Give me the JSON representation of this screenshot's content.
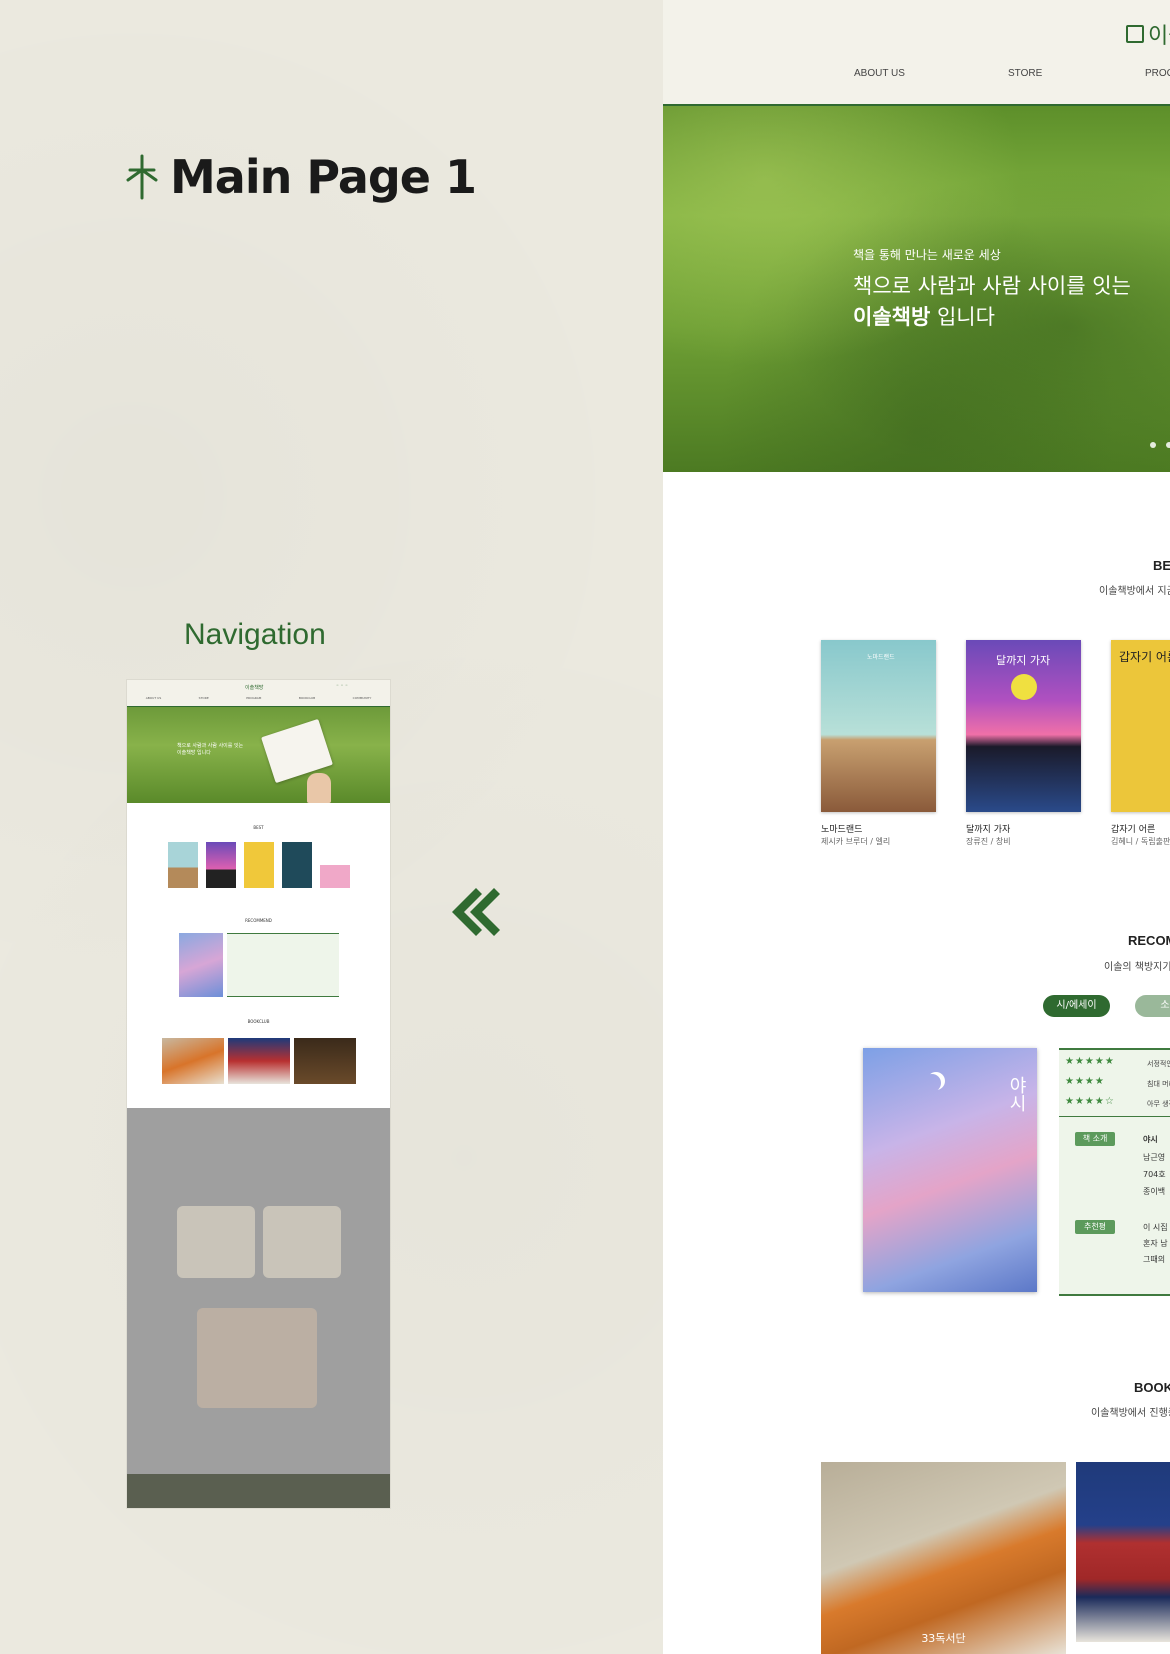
{
  "left": {
    "page_title": "Main Page 1",
    "nav_caption": "Navigation",
    "icons": {
      "title_icon": "tree-icon",
      "arrow_icon": "double-chevron-left-icon"
    }
  },
  "thumbnail": {
    "logo": "이솔책방",
    "menu": [
      "ABOUT US",
      "STORE",
      "PROGRAM",
      "BOOKCLUB",
      "COMMUNITY"
    ],
    "hero_text1": "책으로 사람과 사람 사이를 잇는",
    "hero_text2": "이솔책방 입니다",
    "sections": [
      "BEST",
      "RECOMMEND",
      "BOOKCLUB"
    ]
  },
  "site": {
    "logo": "이솔",
    "nav": [
      "ABOUT US",
      "STORE",
      "PROG"
    ],
    "hero": {
      "subtitle": "책을 통해 만나는 새로운 세상",
      "title_line1": "책으로 사람과 사람 사이를 잇는",
      "title_line2_bold": "이솔책방",
      "title_line2_rest": " 입니다"
    },
    "best": {
      "heading": "BE",
      "subheading": "이솔책방에서 지금",
      "books": [
        {
          "title": "노마드랜드",
          "author": "제시카 브루더 / 엘리",
          "cover_title": "노마드랜드"
        },
        {
          "title": "달까지 가자",
          "author": "장류진 / 창비",
          "cover_title": "달까지 가자"
        },
        {
          "title": "갑자기 어른",
          "author": "김혜니 / 독립출판",
          "cover_title": "갑자기 어른"
        }
      ]
    },
    "recommend": {
      "heading": "RECOM",
      "subheading": "이솔의 책방지기들",
      "tabs": [
        "시/에세이",
        "소"
      ],
      "cover_title": "야시",
      "ratings": [
        {
          "stars": "★★★★★",
          "text": "서정적인"
        },
        {
          "stars": "★★★★",
          "text": "침대 머리"
        },
        {
          "stars": "★★★★☆",
          "text": "아무 생각"
        }
      ],
      "tag_intro": "책 소개",
      "intro_lines": [
        "야시",
        "남근영",
        "704호",
        "종이백"
      ],
      "tag_recommend": "추천평",
      "recommend_lines": [
        "이 시집",
        "혼자 남",
        "그때의"
      ]
    },
    "bookclub": {
      "heading": "BOOKC",
      "subheading": "이솔책방에서 진행중",
      "photo_label": "33독서단"
    }
  },
  "colors": {
    "brand_green": "#2f6a30",
    "paper": "#ebe9df",
    "header_bg": "#f3f2ea"
  }
}
